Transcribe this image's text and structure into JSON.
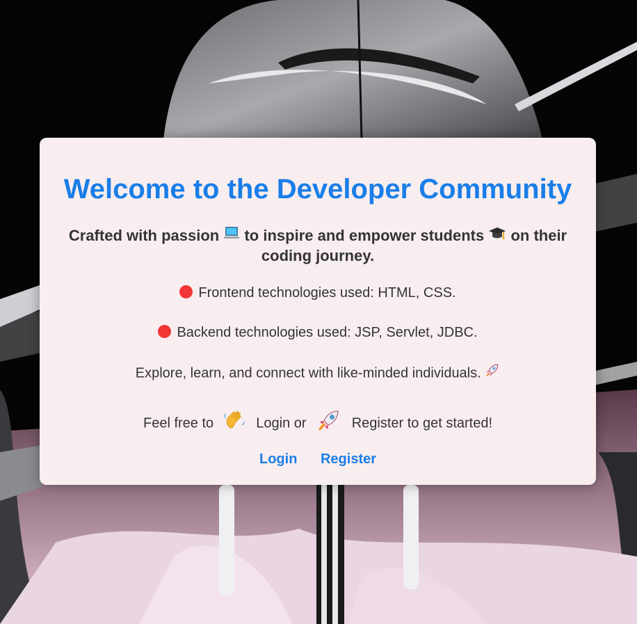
{
  "page": {
    "title": "Welcome to the Developer Community",
    "subtitle_part1": "Crafted with passion",
    "subtitle_part2": "to inspire and empower students",
    "subtitle_part3": "on their coding journey.",
    "frontend_text": "Frontend technologies used: HTML, CSS.",
    "backend_text": "Backend technologies used: JSP, Servlet, JDBC.",
    "explore_text": "Explore, learn, and connect with like-minded individuals.",
    "cta_part1": "Feel free to",
    "cta_part2": "Login or",
    "cta_part3": "Register to get started!"
  },
  "links": {
    "login_label": "Login",
    "register_label": "Register"
  },
  "icons": {
    "subtitle_icon1": "laptop-icon",
    "subtitle_icon2": "graduation-cap-icon",
    "bullet_icon": "red-circle-icon",
    "explore_icon": "rocket-icon",
    "wave_icon": "waving-hand-icon",
    "rocket_icon": "rocket-icon"
  },
  "colors": {
    "accent": "#1a7ee8",
    "card_bg": "#f9eeef",
    "text": "#333333",
    "bullet": "#f23535"
  }
}
